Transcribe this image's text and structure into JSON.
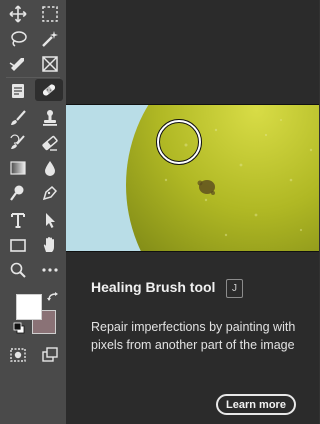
{
  "tooltip": {
    "title": "Healing Brush tool",
    "shortcut": "J",
    "description": "Repair imperfections by painting with pixels from another part of the image",
    "learn_more_label": "Learn more"
  },
  "toolbar": {
    "tools": [
      {
        "icon": "move-icon"
      },
      {
        "icon": "rectangular-marquee-icon"
      },
      {
        "icon": "lasso-icon"
      },
      {
        "icon": "magic-wand-icon"
      },
      {
        "icon": "crop-icon"
      },
      {
        "icon": "frame-icon"
      },
      {
        "icon": "note-icon"
      },
      {
        "icon": "healing-brush-icon",
        "active": true
      },
      {
        "icon": "brush-icon"
      },
      {
        "icon": "clone-stamp-icon"
      },
      {
        "icon": "history-brush-icon"
      },
      {
        "icon": "eraser-icon"
      },
      {
        "icon": "gradient-icon"
      },
      {
        "icon": "blur-icon"
      },
      {
        "icon": "dodge-icon"
      },
      {
        "icon": "pen-icon"
      },
      {
        "icon": "type-icon"
      },
      {
        "icon": "path-selection-icon"
      },
      {
        "icon": "rectangle-icon"
      },
      {
        "icon": "hand-icon"
      },
      {
        "icon": "zoom-icon"
      },
      {
        "icon": "more-tools-icon"
      }
    ],
    "foreground_color": "#ffffff",
    "background_color": "#8a7276"
  },
  "colors": {
    "toolbar_bg": "#4a4a4a",
    "panel_bg": "#2b2b2b",
    "preview_sky": "#b9dde7",
    "apple": "#a9b41f"
  }
}
